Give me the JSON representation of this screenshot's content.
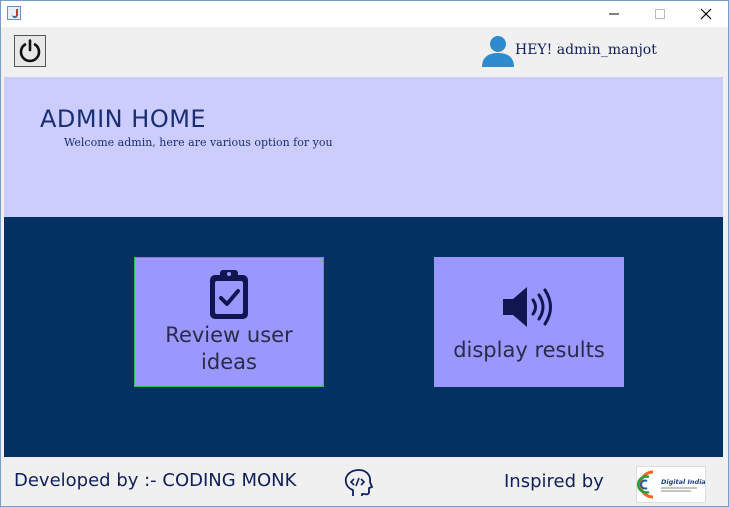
{
  "window": {
    "title": "",
    "icons": {
      "app": "java-icon",
      "minimize": "minimize-icon",
      "maximize": "maximize-icon",
      "close": "close-icon"
    }
  },
  "topbar": {
    "power_icon": "power-icon",
    "user_icon": "user-icon",
    "greeting": "HEY! admin_manjot"
  },
  "header": {
    "title": "ADMIN HOME",
    "subtitle": "Welcome admin, here are various option for you"
  },
  "tiles": [
    {
      "label": "Review user ideas",
      "icon": "clipboard-check-icon"
    },
    {
      "label": "display results",
      "icon": "speaker-icon"
    }
  ],
  "footer": {
    "developed": "Developed by :- CODING MONK",
    "developer_icon": "coder-head-icon",
    "inspired": "Inspired by",
    "logo": "digital-india-logo",
    "logo_text": "Digital India"
  },
  "colors": {
    "header_bg": "#cccdfd",
    "main_bg": "#033262",
    "tile_bg": "#9a98fe",
    "text_dark_blue": "#1a2f73"
  }
}
